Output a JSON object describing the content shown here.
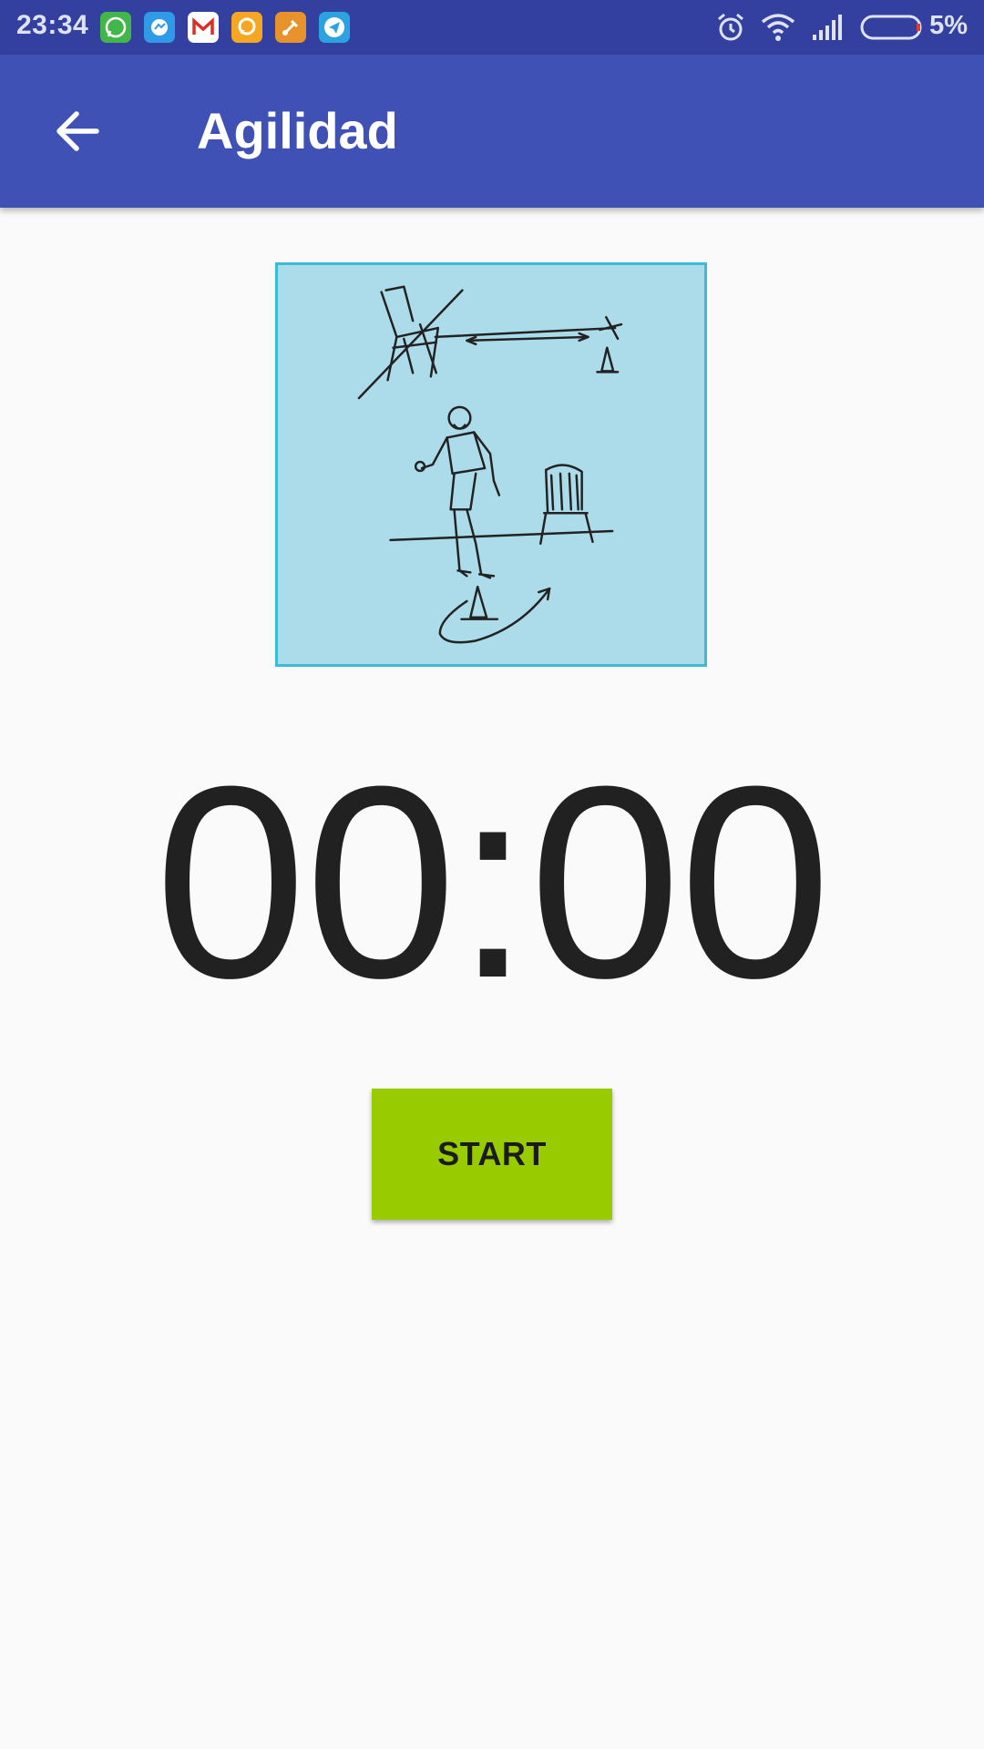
{
  "status_bar": {
    "time": "23:34",
    "notification_icons": [
      "whatsapp-icon",
      "messenger-icon",
      "gmail-icon",
      "chat-icon",
      "brush-app-icon",
      "telegram-icon"
    ],
    "battery_percent": "5%",
    "system_icons": [
      "alarm-icon",
      "wifi-icon",
      "signal-icon",
      "battery-icon"
    ],
    "colors": {
      "background": "#3440a0"
    }
  },
  "app_bar": {
    "title": "Agilidad",
    "back_icon": "arrow-back-icon",
    "colors": {
      "background": "#3f51b5",
      "text": "#ffffff"
    }
  },
  "illustration": {
    "description_icon": "agility-test-illustration-icon",
    "colors": {
      "background": "#acdcea",
      "border": "#3bbcd6"
    }
  },
  "timer": {
    "value": "00:00"
  },
  "start_button": {
    "label": "START",
    "colors": {
      "background": "#99cc00",
      "text": "#1b1b1b"
    }
  }
}
